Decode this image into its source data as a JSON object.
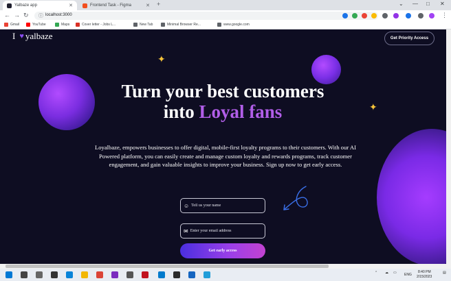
{
  "browser": {
    "tabs": [
      {
        "title": "Yalbaze app",
        "active": true,
        "color": "#1f1f2e"
      },
      {
        "title": "Frontend Task - Figma",
        "active": false,
        "color": "#f24e1e"
      }
    ],
    "new_tab": "+",
    "address": "localhost:3000",
    "bookmarks": [
      {
        "label": "Gmail",
        "color": "#ea4335"
      },
      {
        "label": "YouTube",
        "color": "#ff0000"
      },
      {
        "label": "Maps",
        "color": "#34a853"
      },
      {
        "label": "Cover letter - Jobs L...",
        "color": "#d93025"
      },
      {
        "label": "New Tab",
        "color": "#5f6368"
      },
      {
        "label": "Minimal Browser Re...",
        "color": "#5f6368"
      },
      {
        "label": "www.google.com",
        "color": "#5f6368"
      }
    ]
  },
  "page": {
    "logo_prefix": "I",
    "logo_text": "yalbaze",
    "priority_button": "Get Priority Access",
    "headline_line1": "Turn your best customers",
    "headline_line2_plain": "into ",
    "headline_line2_accent": "Loyal fans",
    "description": "Loyalbaze, empowers businesses to offer digital, mobile-first loyalty programs to their customers. With our AI Powered platform, you can easily create and manage custom loyalty and rewards programs, track customer engagement, and gain valuable insights to improve your business. Sign up now to get early access.",
    "name_placeholder": "Tell us your name",
    "email_placeholder": "Enter your email address",
    "cta_label": "Get early access",
    "colors": {
      "accent": "#b15ee8",
      "background": "#0e0d22",
      "sparkle": "#f6c33a"
    }
  },
  "taskbar": {
    "language": "ENG",
    "time": "8:40 PM",
    "date": "2/15/2023"
  }
}
